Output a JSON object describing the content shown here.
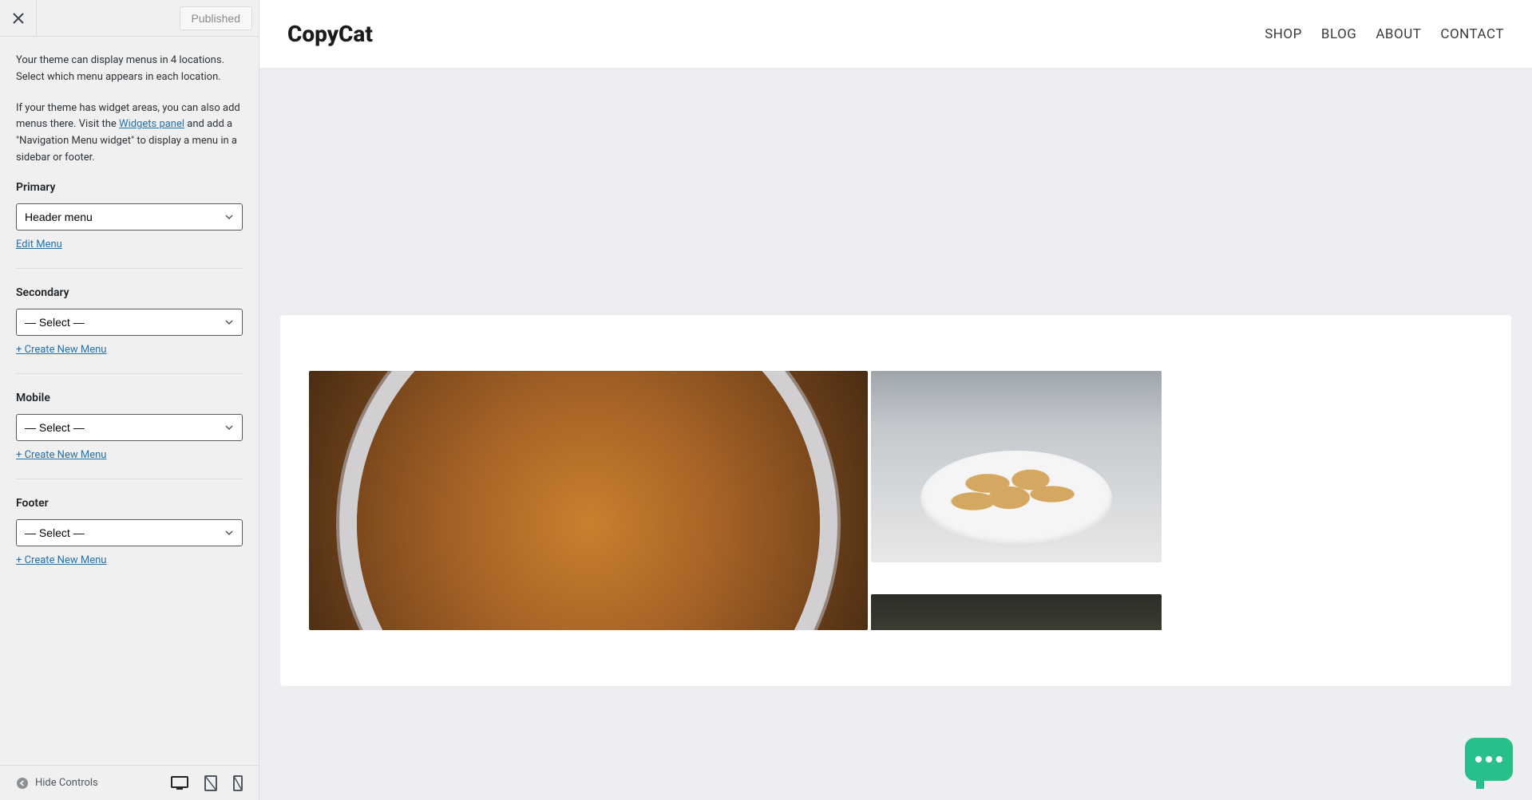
{
  "sidebar": {
    "status_label": "Published",
    "description_1": "Your theme can display menus in 4 locations. Select which menu appears in each location.",
    "description_2_prefix": "If your theme has widget areas, you can also add menus there. Visit the ",
    "widgets_link": "Widgets panel",
    "description_2_suffix": " and add a \"Navigation Menu widget\" to display a menu in a sidebar or footer.",
    "locations": [
      {
        "label": "Primary",
        "selected": "Header menu",
        "action": "Edit Menu",
        "action_type": "edit"
      },
      {
        "label": "Secondary",
        "selected": "— Select —",
        "action": "+ Create New Menu",
        "action_type": "create"
      },
      {
        "label": "Mobile",
        "selected": "— Select —",
        "action": "+ Create New Menu",
        "action_type": "create"
      },
      {
        "label": "Footer",
        "selected": "— Select —",
        "action": "+ Create New Menu",
        "action_type": "create"
      }
    ],
    "hide_controls": "Hide Controls"
  },
  "preview": {
    "site_title": "CopyCat",
    "nav": [
      "SHOP",
      "BLOG",
      "ABOUT",
      "CONTACT"
    ]
  }
}
